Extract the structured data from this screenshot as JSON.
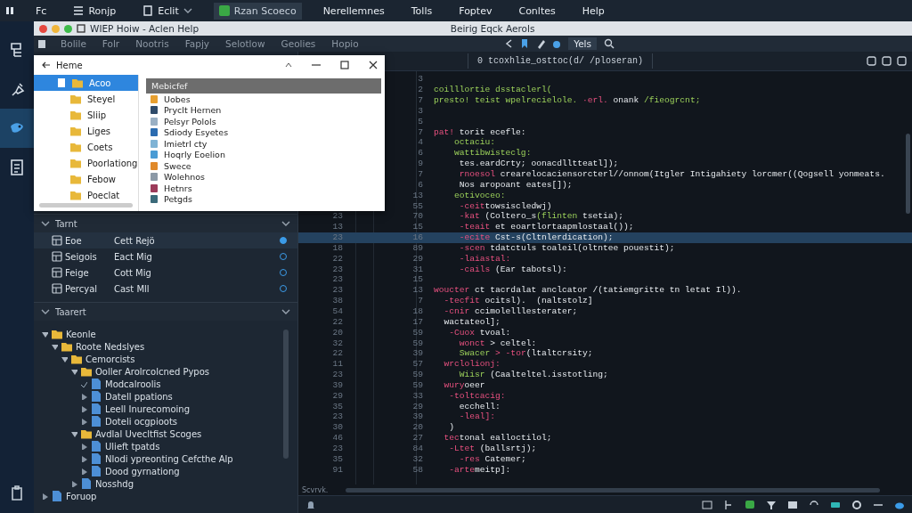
{
  "menubar": {
    "items": [
      {
        "label": "Fc",
        "selected": false
      },
      {
        "label": "Ronjp",
        "selected": false
      },
      {
        "label": "Eclit",
        "selected": false
      },
      {
        "label": "Rzan Scoeco",
        "selected": true
      },
      {
        "label": "Nerellemnes",
        "selected": false
      },
      {
        "label": "Tolls",
        "selected": false
      },
      {
        "label": "Foptev",
        "selected": false
      },
      {
        "label": "Conltes",
        "selected": false
      },
      {
        "label": "Help",
        "selected": false
      }
    ]
  },
  "window": {
    "title": "WIEP Hoiw - Aclen Help",
    "subtitle": "Beirig Eqck Aerols"
  },
  "toolbar": {
    "items": [
      "Bolile",
      "Folr",
      "Nootris",
      "Fapjy",
      "Selotlow",
      "Geolies",
      "Hopio"
    ],
    "right_label": "Yels"
  },
  "explorer": {
    "title": "Heme",
    "sidebar": [
      {
        "label": "Acoo",
        "selected": true
      },
      {
        "label": "Steyel",
        "selected": false
      },
      {
        "label": "Sliip",
        "selected": false
      },
      {
        "label": "Liges",
        "selected": false
      },
      {
        "label": "Coets",
        "selected": false
      },
      {
        "label": "Poorlationg",
        "selected": false
      },
      {
        "label": "Febow",
        "selected": false
      },
      {
        "label": "Poeclat",
        "selected": false
      }
    ],
    "header": "Mebicfef",
    "files": [
      "Uobes",
      "Pryclt Hernen",
      "Pelsyr Polols",
      "Sdiody Esyetes",
      "Imietrl cty",
      "Hoqrly Eoelion",
      "Swece",
      "Wolehnos",
      "Hetnrs",
      "Petgds"
    ]
  },
  "panel": {
    "section1": {
      "title": "Tarnt",
      "rows": [
        {
          "name": "Eoe",
          "value": "Cett Rejö",
          "selected": true
        },
        {
          "name": "Seigois",
          "value": "Eact Mig",
          "selected": false
        },
        {
          "name": "Feige",
          "value": "Cott Mig",
          "selected": false
        },
        {
          "name": "Percyal",
          "value": "Cast Mll",
          "selected": false
        }
      ]
    },
    "section2": {
      "title": "Taarert",
      "tree": [
        {
          "label": "Keonle",
          "expanded": true,
          "children": [
            {
              "label": "Roote Nedslyes",
              "expanded": true,
              "children": [
                {
                  "label": "Cemorcists",
                  "expanded": true,
                  "children": [
                    {
                      "label": "Ooller Arolrcolcned Pypos",
                      "expanded": true,
                      "children": [
                        {
                          "label": "Modcalroolis"
                        },
                        {
                          "label": "Datell ppations",
                          "expanded": false
                        },
                        {
                          "label": "Leell Inurecomoing",
                          "expanded": false
                        },
                        {
                          "label": "Doteli ocgpioots",
                          "expanded": false
                        }
                      ]
                    },
                    {
                      "label": "Avdlal Uvecltfist Scoges",
                      "expanded": true,
                      "children": [
                        {
                          "label": "Ulieft tpatds",
                          "expanded": false
                        },
                        {
                          "label": "Nlodi ypreonting Cefcthe Alp",
                          "expanded": false
                        },
                        {
                          "label": "Dood gyrnationg",
                          "expanded": false
                        }
                      ]
                    },
                    {
                      "label": "Nosshdg",
                      "expanded": false
                    }
                  ]
                }
              ]
            }
          ]
        },
        {
          "label": "Foruop",
          "expanded": false
        }
      ]
    }
  },
  "editor": {
    "tab": "0 tcoxhlie_osttoc(d/ /ploseran)",
    "footer": "Scvrvk.",
    "lines": [
      {
        "num": "3",
        "current": false
      },
      {
        "num": "2",
        "current": false,
        "segments": [
          {
            "kind": "fn",
            "text": "coilllortie dsstaclerl("
          }
        ]
      },
      {
        "num": "7",
        "current": false,
        "segments": [
          {
            "kind": "fn",
            "text": "presto! teist wpelrecielole."
          },
          {
            "kind": "kw",
            "text": " ·erl."
          },
          {
            "kind": "tx",
            "text": " onank "
          },
          {
            "kind": "fn",
            "text": "/fieogrcnt;"
          }
        ]
      },
      {
        "num": "3",
        "current": false
      },
      {
        "num": "5",
        "current": false
      },
      {
        "num": "7",
        "current": false,
        "segments": [
          {
            "kind": "kw",
            "text": "pat!"
          },
          {
            "kind": "tx",
            "text": " torit ecefle:"
          }
        ]
      },
      {
        "num": "4",
        "current": false,
        "segments": [
          {
            "kind": "fn",
            "text": "    octaciu:"
          }
        ]
      },
      {
        "num": "6",
        "current": false,
        "segments": [
          {
            "kind": "fn",
            "text": "    wattibwisteclg:"
          }
        ]
      },
      {
        "num": "9",
        "current": false,
        "segments": [
          {
            "kind": "tx",
            "text": "     tes.eardCrty; oonacdlltteatl]);"
          }
        ]
      },
      {
        "num": "7",
        "current": false,
        "segments": [
          {
            "kind": "kw",
            "text": "     rnoesol"
          },
          {
            "kind": "tx",
            "text": " crearelocaciensorcterl//onnom(Itgler Intigahiety lorcmer((Qogsell yonmeats."
          }
        ]
      },
      {
        "num": "6",
        "current": false,
        "segments": [
          {
            "kind": "tx",
            "text": "     Nos aropoant eates[]);"
          }
        ]
      },
      {
        "num": "13",
        "current": false,
        "segments": [
          {
            "kind": "fn",
            "text": "    eotivoceo:"
          }
        ]
      },
      {
        "num": "55",
        "current": false,
        "segments": [
          {
            "kind": "kw",
            "text": "     -ceit"
          },
          {
            "kind": "tx",
            "text": "towsiscledwj)"
          }
        ]
      },
      {
        "outer": "23",
        "num": "70",
        "current": false,
        "segments": [
          {
            "kind": "kw",
            "text": "     -kat"
          },
          {
            "kind": "tx",
            "text": " (Coltero_s"
          },
          {
            "kind": "fn",
            "text": "(flinten"
          },
          {
            "kind": "tx",
            "text": " tsetia);"
          }
        ]
      },
      {
        "outer": "13",
        "num": "15",
        "current": false,
        "segments": [
          {
            "kind": "kw",
            "text": "     -teait"
          },
          {
            "kind": "tx",
            "text": " et eoartlortaapmlostaal());"
          }
        ]
      },
      {
        "outer": "23",
        "num": "16",
        "current": true,
        "segments": [
          {
            "kind": "kw",
            "text": "     -ecite"
          },
          {
            "kind": "tx",
            "text": " Cst-s(Cltnlerdication);"
          }
        ]
      },
      {
        "outer": "18",
        "num": "89",
        "current": false,
        "segments": [
          {
            "kind": "kw",
            "text": "     -scen"
          },
          {
            "kind": "tx",
            "text": " tdatctuls toaleil(oltntee pouestit);"
          }
        ]
      },
      {
        "outer": "22",
        "num": "29",
        "current": false,
        "segments": [
          {
            "kind": "kw",
            "text": "     -laiastal:"
          }
        ]
      },
      {
        "outer": "23",
        "num": "31",
        "current": false,
        "segments": [
          {
            "kind": "kw",
            "text": "     -cails"
          },
          {
            "kind": "tx",
            "text": " (Ear tabotsl):"
          }
        ]
      },
      {
        "outer": "23",
        "num": "15",
        "current": false
      },
      {
        "outer": "23",
        "num": "13",
        "current": false,
        "segments": [
          {
            "kind": "kw",
            "text": "woucter"
          },
          {
            "kind": "tx",
            "text": " ct tacrdalat anclcator /(tatiemgritte tn letat Il))."
          }
        ]
      },
      {
        "outer": "38",
        "num": "7",
        "current": false,
        "segments": [
          {
            "kind": "kw",
            "text": "  -tecfit"
          },
          {
            "kind": "tx",
            "text": " ocitsl).  (naltstolz]"
          }
        ]
      },
      {
        "outer": "54",
        "num": "18",
        "current": false,
        "segments": [
          {
            "kind": "kw",
            "text": "  -cnir"
          },
          {
            "kind": "tx",
            "text": " ccimolelllesterater;"
          }
        ]
      },
      {
        "outer": "22",
        "num": "17",
        "current": false,
        "segments": [
          {
            "kind": "tx",
            "text": "  wactateol];"
          }
        ]
      },
      {
        "outer": "20",
        "num": "59",
        "current": false,
        "segments": [
          {
            "kind": "kw",
            "text": "   -Cuox"
          },
          {
            "kind": "tx",
            "text": " tvoal:"
          }
        ]
      },
      {
        "outer": "32",
        "num": "59",
        "current": false,
        "segments": [
          {
            "kind": "kw",
            "text": "     wonct"
          },
          {
            "kind": "tx",
            "text": " > celtel:"
          }
        ]
      },
      {
        "outer": "22",
        "num": "39",
        "current": false,
        "segments": [
          {
            "kind": "fn",
            "text": "     Swacer"
          },
          {
            "kind": "kw",
            "text": " > -tor"
          },
          {
            "kind": "tx",
            "text": "(ltaltcrsity;"
          }
        ]
      },
      {
        "outer": "11",
        "num": "57",
        "current": false,
        "segments": [
          {
            "kind": "kw",
            "text": "  wrclolionj:"
          }
        ]
      },
      {
        "outer": "23",
        "num": "59",
        "current": false,
        "segments": [
          {
            "kind": "fn",
            "text": "     Wiisr"
          },
          {
            "kind": "tx",
            "text": " (Caalteltel.isstotling;"
          }
        ]
      },
      {
        "outer": "39",
        "num": "59",
        "current": false,
        "segments": [
          {
            "kind": "kw",
            "text": "  wury"
          },
          {
            "kind": "tx",
            "text": "oeer"
          }
        ]
      },
      {
        "outer": "29",
        "num": "33",
        "current": false,
        "segments": [
          {
            "kind": "kw",
            "text": "   -toltcacig:"
          }
        ]
      },
      {
        "outer": "35",
        "num": "29",
        "current": false,
        "segments": [
          {
            "kind": "tx",
            "text": "     ecchell:"
          }
        ]
      },
      {
        "outer": "23",
        "num": "39",
        "current": false,
        "segments": [
          {
            "kind": "kw",
            "text": "     -leal]:"
          }
        ]
      },
      {
        "outer": "30",
        "num": "20",
        "current": false,
        "segments": [
          {
            "kind": "tx",
            "text": "   )"
          }
        ]
      },
      {
        "outer": "46",
        "num": "27",
        "current": false,
        "segments": [
          {
            "kind": "kw",
            "text": "  tec"
          },
          {
            "kind": "tx",
            "text": "tonal ealloctilol;"
          }
        ]
      },
      {
        "outer": "23",
        "num": "84",
        "current": false,
        "segments": [
          {
            "kind": "kw",
            "text": "   -Ltet"
          },
          {
            "kind": "tx",
            "text": " (ballsrtj);"
          }
        ]
      },
      {
        "outer": "35",
        "num": "32",
        "current": false,
        "segments": [
          {
            "kind": "kw",
            "text": "     -res"
          },
          {
            "kind": "tx",
            "text": " Catemer;"
          }
        ]
      },
      {
        "outer": "91",
        "num": "58",
        "current": false,
        "segments": [
          {
            "kind": "kw",
            "text": "   -arte"
          },
          {
            "kind": "tx",
            "text": "meitp]:"
          }
        ]
      }
    ]
  }
}
